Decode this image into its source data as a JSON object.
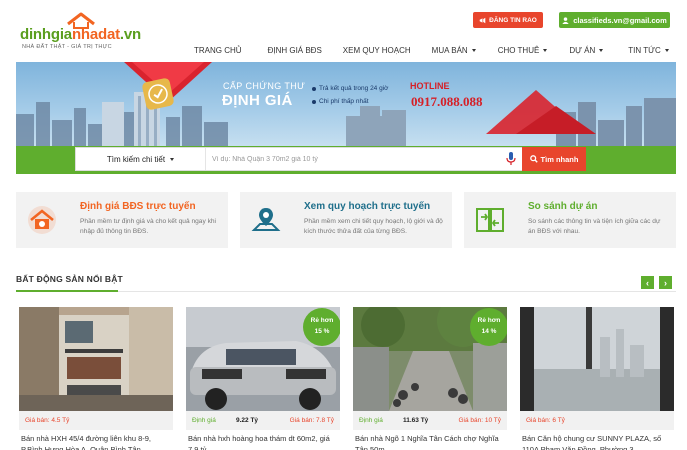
{
  "logo": {
    "name_green": "dinhgia",
    "name_orange": "nhadat",
    "name_tld": ".vn",
    "tagline": "NHÀ ĐẤT THẬT - GIÁ TRỊ THỰC"
  },
  "header": {
    "post_button": "ĐĂNG TIN RAO",
    "email_button": "classifieds.vn@gmail.com"
  },
  "nav": [
    {
      "label": "Trang chủ",
      "dropdown": false
    },
    {
      "label": "Định giá BĐS",
      "dropdown": false
    },
    {
      "label": "Xem quy hoạch",
      "dropdown": false
    },
    {
      "label": "Mua bán",
      "dropdown": true
    },
    {
      "label": "Cho thuê",
      "dropdown": true
    },
    {
      "label": "Dự án",
      "dropdown": true
    },
    {
      "label": "Tin tức",
      "dropdown": true
    }
  ],
  "banner": {
    "line1": "CẤP CHỨNG THƯ",
    "line2": "ĐỊNH GIÁ",
    "bullets": [
      "Trả kết quả trong 24 giờ",
      "Chi phí thấp nhất"
    ],
    "hotline_label": "HOTLINE",
    "hotline_number": "0917.088.088"
  },
  "search": {
    "selector_label": "Tìm kiếm chi tiết",
    "placeholder": "Ví dụ: Nhà Quận 3 70m2 giá 10 tỷ",
    "button_label": "Tìm nhanh"
  },
  "features": [
    {
      "title": "Định giá BĐS trực tuyến",
      "desc": "Phần mềm tư định giá và cho kết quả ngay khi nhập đủ thông tin BĐS.",
      "color": "#f26522"
    },
    {
      "title": "Xem quy hoạch trực tuyến",
      "desc": "Phần mềm xem chi tiết quy hoạch, lộ giới và độ kích thước thửa đất của từng BĐS.",
      "color": "#1f6f8b"
    },
    {
      "title": "So sánh dự án",
      "desc": "So sánh các thông tin và tiện ích giữa các dự án BĐS với nhau.",
      "color": "#5fae2e"
    }
  ],
  "section": {
    "title": "BẤT ĐỘNG SẢN NỔI BẬT",
    "prev": "‹",
    "next": "›"
  },
  "listings": [
    {
      "badge": "",
      "valuation_label": "",
      "valuation": "",
      "price_label": "Giá bán:",
      "price": "4.5 Tỷ",
      "title": "Bán nhà HXH 45/4 đường liên khu 8-9, P.Bình Hưng Hòa A, Quận Bình Tân"
    },
    {
      "badge": "",
      "valuation_label": "Định giá",
      "valuation": "9.22 Tỷ",
      "price_label": "Giá bán:",
      "price": "7.8 Tỷ",
      "title": "Bán nhà hxh hoàng hoa thám dt 60m2, giá 7.9 tỷ"
    },
    {
      "badge": "Rẻ hơn\n14 %",
      "valuation_label": "Định giá",
      "valuation": "11.63 Tỷ",
      "price_label": "Giá bán:",
      "price": "10 Tỷ",
      "title": "Bán nhà Ngõ 1 Nghĩa Tân Cách chợ Nghĩa Tân 50m"
    },
    {
      "badge": "",
      "valuation_label": "",
      "valuation": "",
      "price_label": "Giá bán:",
      "price": "6 Tỷ",
      "title": "Bán Căn hộ chung cư SUNNY PLAZA, số 110A Phạm Văn Đồng, Phường 3,"
    }
  ],
  "badge_card1": {
    "line1": "Rẻ hơn",
    "line2": "15 %"
  },
  "badge_card2": {
    "line1": "Rẻ hơn",
    "line2": "14 %"
  }
}
